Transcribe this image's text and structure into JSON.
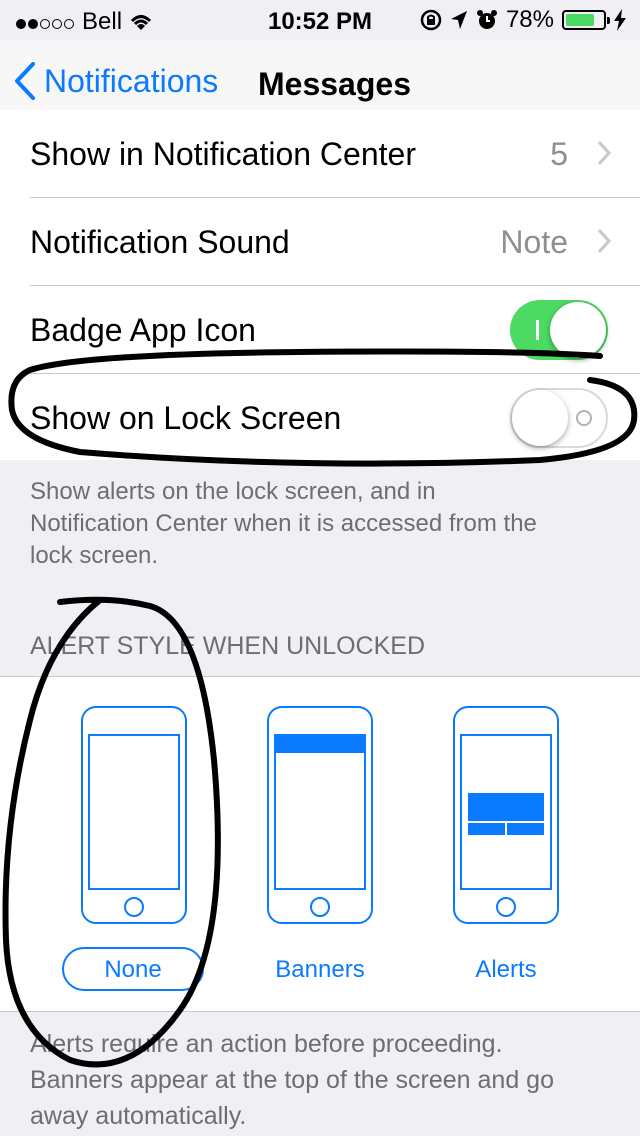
{
  "status_bar": {
    "carrier": "Bell",
    "time": "10:52 PM",
    "battery": "78%",
    "battery_level": 0.78
  },
  "nav": {
    "back_label": "Notifications",
    "title": "Messages"
  },
  "rows": {
    "show_in_nc": {
      "label": "Show in Notification Center",
      "value": "5"
    },
    "sound": {
      "label": "Notification Sound",
      "value": "Note"
    },
    "badge": {
      "label": "Badge App Icon",
      "enabled": true
    },
    "lock": {
      "label": "Show on Lock Screen",
      "enabled": false
    }
  },
  "lock_footer": {
    "line1": "Show alerts on the lock screen, and in",
    "line2": "Notification Center when it is accessed from the",
    "line3": "lock screen."
  },
  "alert_section": {
    "header": "ALERT STYLE WHEN UNLOCKED",
    "options": [
      "None",
      "Banners",
      "Alerts"
    ],
    "selected": "None"
  },
  "alert_footer": {
    "line1": "Alerts require an action before proceeding.",
    "line2": "Banners appear at the top of the screen and go",
    "line3": "away automatically."
  },
  "colors": {
    "accent": "#0a7aff",
    "toggle_on": "#4cd964",
    "background": "#efeff4"
  }
}
